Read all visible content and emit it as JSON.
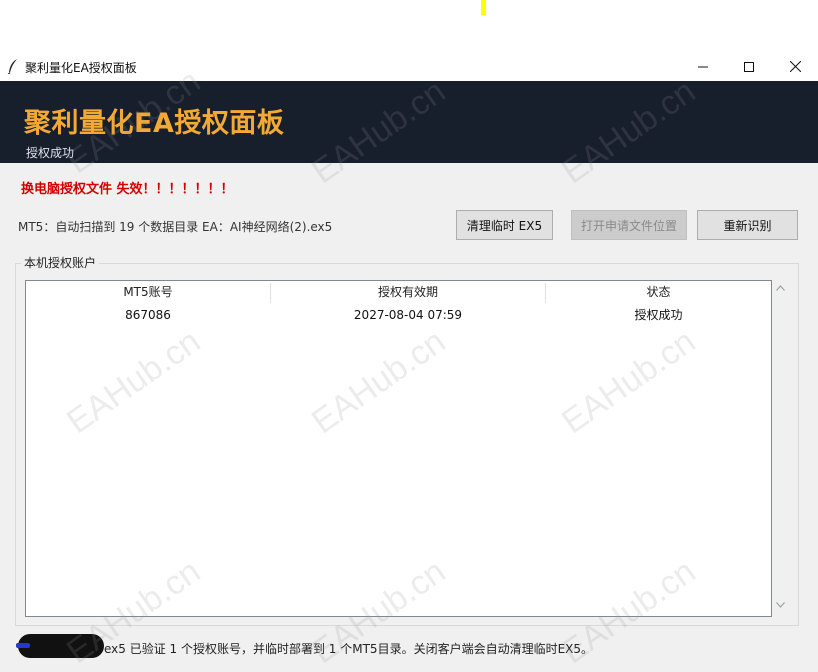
{
  "window": {
    "title": "聚利量化EA授权面板",
    "controls": [
      "minimize",
      "maximize",
      "close"
    ]
  },
  "header": {
    "title": "聚利量化EA授权面板",
    "subtitle": "授权成功"
  },
  "warning": "换电脑授权文件 失效！！！！！！！",
  "scan_info": "MT5：自动扫描到 19 个数据目录    EA：AI神经网络(2).ex5",
  "buttons": {
    "clean": "清理临时 EX5",
    "open_location": "打开申请文件位置",
    "rescan": "重新识别"
  },
  "accounts": {
    "label": "本机授权账户",
    "columns": [
      "MT5账号",
      "授权有效期",
      "状态"
    ],
    "rows": [
      [
        "867086",
        "2027-08-04 07:59",
        "授权成功"
      ]
    ]
  },
  "footer": "ex5 已验证 1 个授权账号，并临时部署到 1 个MT5目录。关闭客户端会自动清理临时EX5。",
  "watermark": "EAHub.cn",
  "colors": {
    "header_bg": "#171e2c",
    "title_accent": "#f3a933",
    "warning_red": "#d40000"
  }
}
